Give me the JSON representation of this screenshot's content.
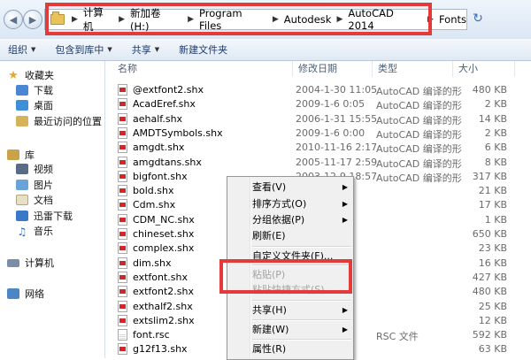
{
  "address_bar": {
    "crumbs": [
      "计算机",
      "新加卷 (H:)",
      "Program Files",
      "Autodesk",
      "AutoCAD 2014",
      "Fonts"
    ]
  },
  "toolbar": {
    "organize": "组织",
    "include_in_library": "包含到库中",
    "share": "共享",
    "new_folder": "新建文件夹"
  },
  "nav": {
    "favorites": "收藏夹",
    "downloads": "下载",
    "desktop": "桌面",
    "recent": "最近访问的位置",
    "libraries": "库",
    "videos": "视频",
    "pictures": "图片",
    "documents": "文档",
    "thunder": "迅雷下载",
    "music": "音乐",
    "computer": "计算机",
    "network": "网络"
  },
  "columns": {
    "name": "名称",
    "modified": "修改日期",
    "type": "类型",
    "size": "大小"
  },
  "files": [
    {
      "name": "@extfont2.shx",
      "date": "2004-1-30 11:05",
      "type": "AutoCAD 编译的形",
      "size": "480 KB"
    },
    {
      "name": "AcadEref.shx",
      "date": "2009-1-6 0:05",
      "type": "AutoCAD 编译的形",
      "size": "2 KB"
    },
    {
      "name": "aehalf.shx",
      "date": "2006-1-31 15:55",
      "type": "AutoCAD 编译的形",
      "size": "14 KB"
    },
    {
      "name": "AMDTSymbols.shx",
      "date": "2009-1-6 0:00",
      "type": "AutoCAD 编译的形",
      "size": "2 KB"
    },
    {
      "name": "amgdt.shx",
      "date": "2010-11-16 2:17",
      "type": "AutoCAD 编译的形",
      "size": "6 KB"
    },
    {
      "name": "amgdtans.shx",
      "date": "2005-11-17 2:59",
      "type": "AutoCAD 编译的形",
      "size": "8 KB"
    },
    {
      "name": "bigfont.shx",
      "date": "2003-12-9 18:57",
      "type": "AutoCAD 编译的形",
      "size": "317 KB"
    },
    {
      "name": "bold.shx",
      "date": "",
      "type": "",
      "size": "21 KB"
    },
    {
      "name": "Cdm.shx",
      "date": "",
      "type": "",
      "size": "17 KB"
    },
    {
      "name": "CDM_NC.shx",
      "date": "",
      "type": "",
      "size": "1 KB"
    },
    {
      "name": "chineset.shx",
      "date": "6",
      "type": "",
      "size": "650 KB"
    },
    {
      "name": "complex.shx",
      "date": "6",
      "type": "",
      "size": "23 KB"
    },
    {
      "name": "dim.shx",
      "date": "",
      "type": "",
      "size": "16 KB"
    },
    {
      "name": "extfont.shx",
      "date": "40",
      "type": "",
      "size": "427 KB"
    },
    {
      "name": "extfont2.shx",
      "date": "",
      "type": "",
      "size": "480 KB"
    },
    {
      "name": "exthalf2.shx",
      "date": "",
      "type": "",
      "size": "25 KB"
    },
    {
      "name": "extslim2.shx",
      "date": "",
      "type": "",
      "size": "12 KB"
    },
    {
      "name": "font.rsc",
      "date": "43",
      "type": "RSC 文件",
      "size": "592 KB"
    },
    {
      "name": "g12f13.shx",
      "date": "",
      "type": "",
      "size": "63 KB"
    }
  ],
  "context_menu": {
    "view": "查看(V)",
    "sort_by": "排序方式(O)",
    "group_by": "分组依据(P)",
    "refresh": "刷新(E)",
    "customize_folder": "自定义文件夹(F)...",
    "paste": "粘贴(P)",
    "paste_shortcut": "粘贴快捷方式(S)",
    "share_with": "共享(H)",
    "new": "新建(W)",
    "properties": "属性(R)"
  },
  "colors": {
    "highlight_frame": "#e53a3a",
    "folder": "#e8c25a",
    "file_badge": "#cc2a2a"
  }
}
